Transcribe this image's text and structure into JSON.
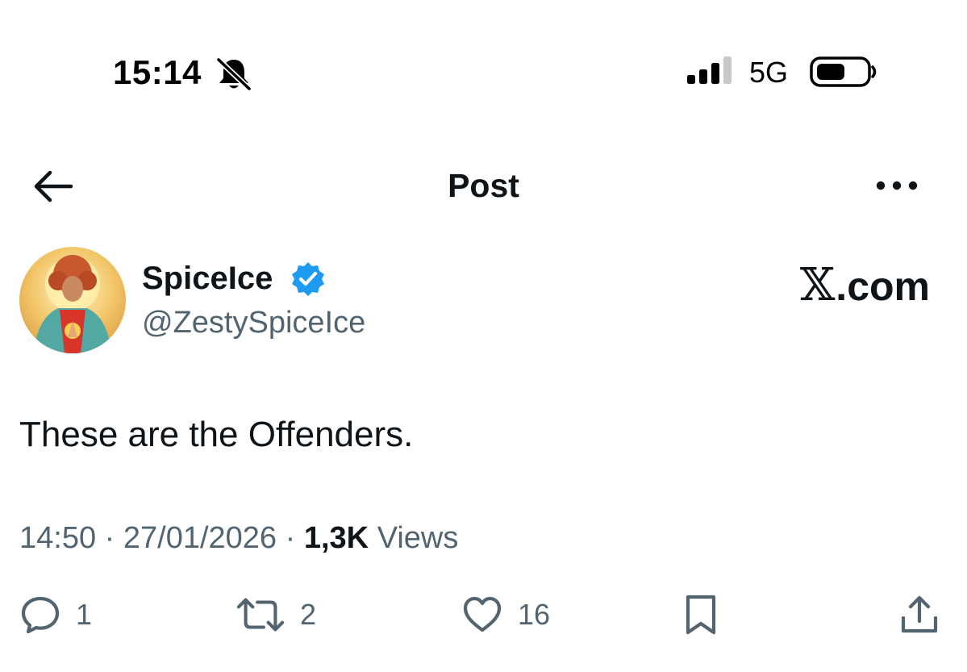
{
  "status_bar": {
    "time": "15:14",
    "network": "5G",
    "icons": [
      "bell-slash-icon",
      "signal-bars-icon",
      "battery-icon"
    ]
  },
  "nav": {
    "title": "Post",
    "icons": [
      "back-arrow-icon",
      "more-dots-icon"
    ]
  },
  "author": {
    "display_name": "SpiceIce",
    "handle": "@ZestySpiceIce",
    "verified": true,
    "verified_color": "#1d9bf0"
  },
  "watermark": {
    "x_mark": "𝕏",
    "domain": ".com"
  },
  "post": {
    "text": "These are the Offenders.",
    "time": "14:50",
    "date": "27/01/2026",
    "views_count": "1,3K",
    "views_label": "Views",
    "separator": "·"
  },
  "actions": {
    "reply_count": "1",
    "repost_count": "2",
    "like_count": "16",
    "icons": [
      "reply-icon",
      "repost-icon",
      "like-icon",
      "bookmark-icon",
      "share-icon"
    ]
  },
  "colors": {
    "text_primary": "#0f1419",
    "text_secondary": "#536471",
    "background": "#ffffff"
  }
}
